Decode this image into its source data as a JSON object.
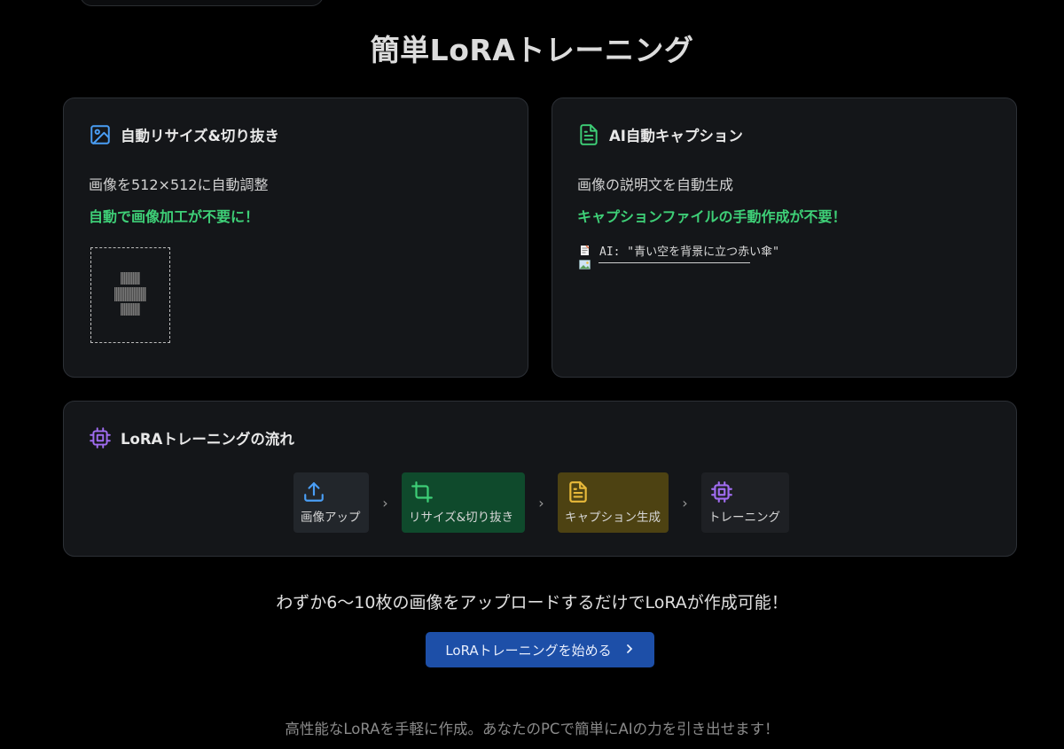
{
  "page": {
    "title": "簡単LoRAトレーニング",
    "tagline": "わずか6〜10枚の画像をアップロードするだけでLoRAが作成可能！",
    "cta_label": "LoRAトレーニングを始める",
    "footer": "高性能なLoRAを手軽に作成。あなたのPCで簡単にAIの力を引き出せます！"
  },
  "features": [
    {
      "title": "自動リサイズ&切り抜き",
      "description": "画像を512×512に自動調整",
      "highlight": "自動で画像加工が不要に！",
      "icon": "image-icon",
      "icon_color": "#4a9ef5"
    },
    {
      "title": "AI自動キャプション",
      "description": "画像の説明文を自動生成",
      "highlight": "キャプションファイルの手動作成が不要！",
      "icon": "document-icon",
      "icon_color": "#3ecf77",
      "sample_caption": "AI: \"青い空を背景に立つ赤い傘\""
    }
  ],
  "workflow": {
    "title": "LoRAトレーニングの流れ",
    "icon": "cpu-icon",
    "icon_color": "#a06cf0",
    "steps": [
      {
        "label": "画像アップ",
        "icon": "upload-icon",
        "bg": "#22262b",
        "icon_color": "#4a9ef5"
      },
      {
        "label": "リサイズ&切り抜き",
        "icon": "crop-icon",
        "bg": "#0f4a2c",
        "icon_color": "#3ecf77"
      },
      {
        "label": "キャプション生成",
        "icon": "document-icon",
        "bg": "#4d4212",
        "icon_color": "#e8b93a"
      },
      {
        "label": "トレーニング",
        "icon": "cpu-icon",
        "bg": "#1e2024",
        "icon_color": "#a06cf0"
      }
    ]
  },
  "colors": {
    "accent_green": "#3ecf77",
    "cta_bg": "#1d4fa8",
    "background": "#000000",
    "card_bg": "#141619"
  }
}
